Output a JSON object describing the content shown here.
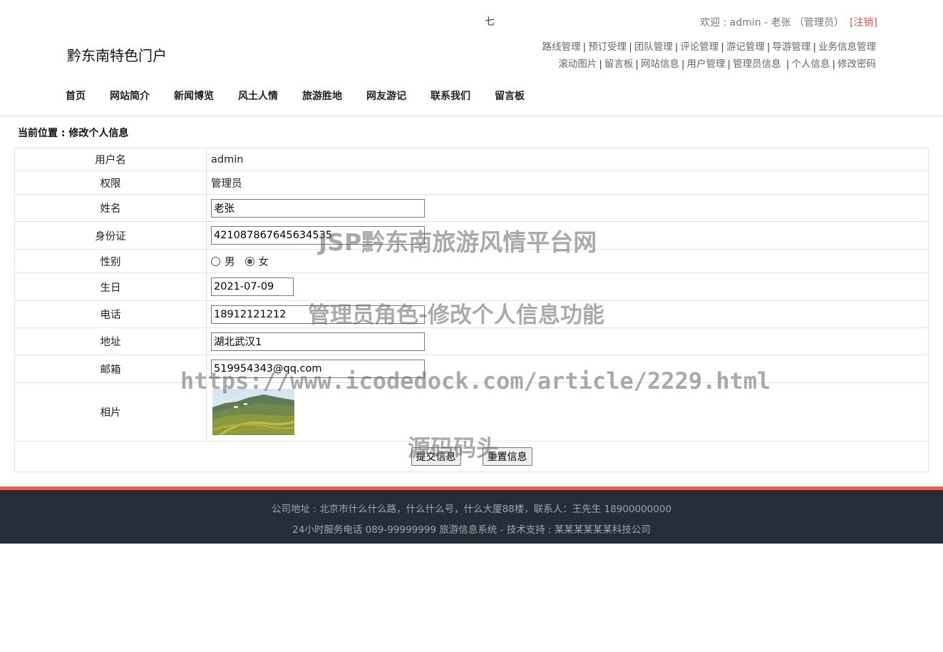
{
  "header": {
    "top_char": "七",
    "welcome_text": "欢迎 : admin - 老张 （管理员）",
    "logout_label": "[注销]",
    "site_title": "黔东南特色门户",
    "admin_links_row1": [
      "路线管理",
      "预订受理",
      "团队管理",
      "评论管理",
      "游记管理",
      "导游管理",
      "业务信息管理"
    ],
    "admin_links_row2": [
      "滚动图片",
      "留言板",
      "网站信息",
      "用户管理",
      "管理员信息",
      "个人信息",
      "修改密码"
    ]
  },
  "nav": [
    "首页",
    "网站简介",
    "新闻博览",
    "风土人情",
    "旅游胜地",
    "网友游记",
    "联系我们",
    "留言板"
  ],
  "breadcrumb": "当前位置 : 修改个人信息",
  "form": {
    "username_label": "用户名",
    "username_value": "admin",
    "permission_label": "权限",
    "permission_value": "管理员",
    "name_label": "姓名",
    "name_value": "老张",
    "idcard_label": "身份证",
    "idcard_value": "421087867645634535",
    "gender_label": "性别",
    "gender_male": "男",
    "gender_female": "女",
    "gender_selected": "女",
    "birthday_label": "生日",
    "birthday_value": "2021-07-09",
    "phone_label": "电话",
    "phone_value": "18912121212",
    "address_label": "地址",
    "address_value": "湖北武汉1",
    "email_label": "邮箱",
    "email_value": "519954343@qq.com",
    "photo_label": "相片",
    "submit_label": "提交信息",
    "reset_label": "重置信息"
  },
  "watermarks": [
    "JSP黔东南旅游风情平台网",
    "管理员角色-修改个人信息功能",
    "https://www.icodedock.com/article/2229.html",
    "源码码头"
  ],
  "footer": {
    "line1": "公司地址 : 北京市什么什么路，什么什么号，什么大厦88楼，联系人：王先生 18900000000",
    "line2": "24小时服务电话   089-99999999   旅游信息系统 - 技术支持 : 某某某某某某科技公司"
  },
  "colors": {
    "footer_bg": "#242d38",
    "footer_accent": "#e2624f",
    "logout": "#d9534f"
  }
}
